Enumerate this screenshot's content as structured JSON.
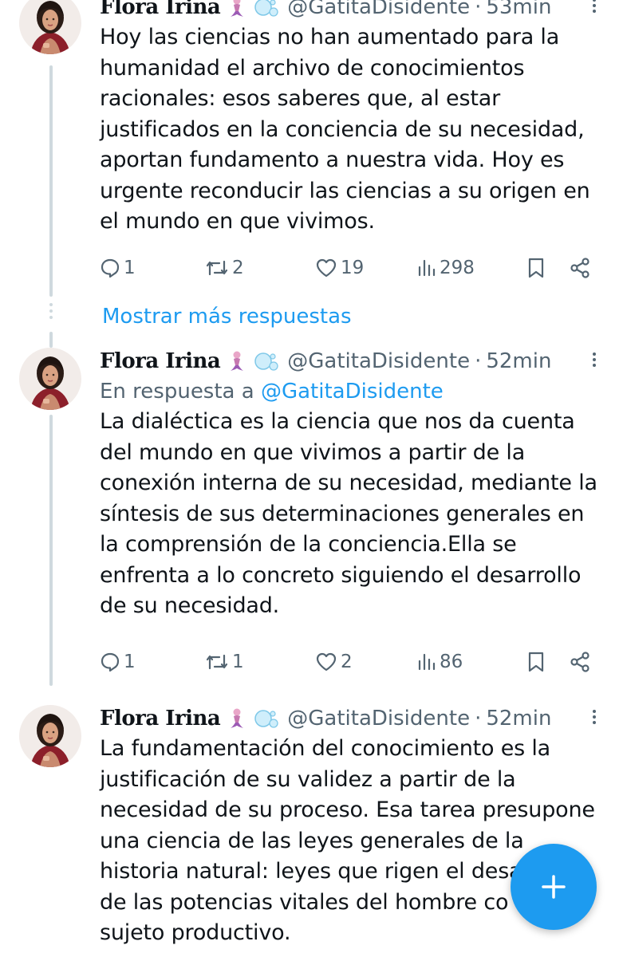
{
  "tweets": [
    {
      "author": "Flora Irina",
      "handle": "@GatitaDisidente",
      "separator": "·",
      "time": "53min",
      "text": "Hoy las ciencias no han aumentado para la\nhumanidad el archivo de conocimientos\nracionales: esos saberes que, al estar\njustificados en la conciencia de su necesidad,\naportan fundamento a nuestra vida. Hoy es\nurgente reconducir las ciencias a su origen en\nel mundo en que vivimos.",
      "replies": "1",
      "retweets": "2",
      "likes": "19",
      "views": "298"
    },
    {
      "author": "Flora Irina",
      "handle": "@GatitaDisidente",
      "separator": "·",
      "time": "52min",
      "reply_prefix": "En respuesta a ",
      "reply_mention": "@GatitaDisidente",
      "text": "La dialéctica es la ciencia que nos da cuenta\ndel mundo en que vivimos a partir de la\nconexión interna de su necesidad, mediante la\nsíntesis de sus determinaciones generales en\nla comprensión de la conciencia.Ella se\nenfrenta a lo concreto siguiendo el desarrollo\nde su necesidad.",
      "replies": "1",
      "retweets": "1",
      "likes": "2",
      "views": "86"
    },
    {
      "author": "Flora Irina",
      "handle": "@GatitaDisidente",
      "separator": "·",
      "time": "52min",
      "text": "La fundamentación del conocimiento es la\njustificación de su validez a partir de la\nnecesidad de su proceso. Esa tarea presupone\nuna ciencia de las leyes generales de la\nhistoria natural: leyes que rigen el desa\nde las potencias vitales del hombre co\nsujeto productivo."
    }
  ],
  "show_more_label": "Mostrar más respuestas",
  "icons": {
    "author_emoji": "mermaid-emoji-icon",
    "author_emoji_2": "bubbles-emoji-icon",
    "reply": "reply-icon",
    "retweet": "retweet-icon",
    "like": "heart-icon",
    "views": "views-icon",
    "bookmark": "bookmark-icon",
    "share": "share-icon",
    "more": "more-icon",
    "fab": "plus-icon"
  },
  "colors": {
    "accent": "#1d9bf0",
    "secondary_text": "#536471",
    "primary_text": "#0f1419",
    "thread_line": "#cfd9de"
  }
}
